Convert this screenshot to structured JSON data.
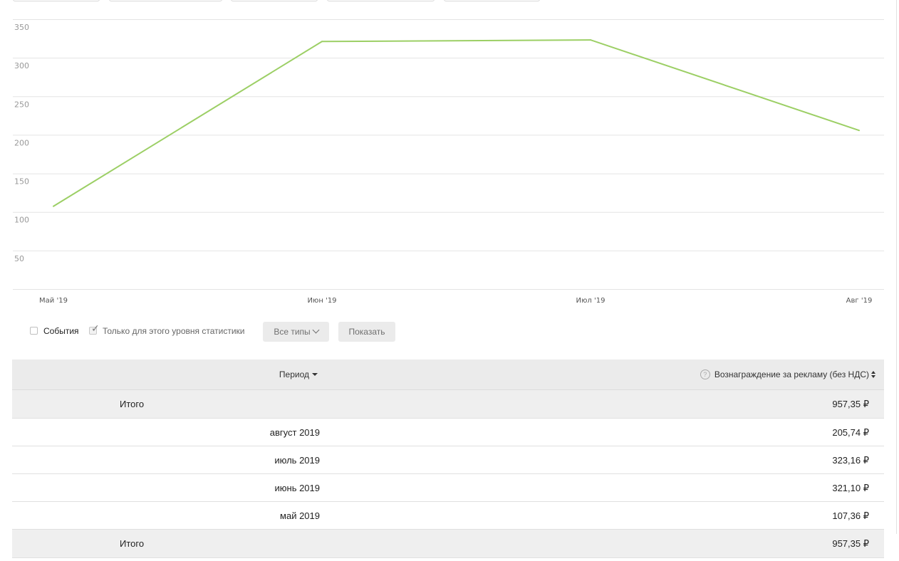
{
  "chart_data": {
    "type": "line",
    "categories": [
      "Май '19",
      "Июн '19",
      "Июл '19",
      "Авг '19"
    ],
    "series": [
      {
        "values": [
          107.36,
          321.1,
          323.16,
          205.74
        ]
      }
    ],
    "yticks": [
      50,
      100,
      150,
      200,
      250,
      300,
      350
    ],
    "ylim": [
      0,
      350
    ],
    "grid": true,
    "color": "#9ccf65"
  },
  "controls": {
    "events_label": "События",
    "events_checked": false,
    "only_level_label": "Только для этого уровня статистики",
    "only_level_checked": true,
    "types_button": "Все типы",
    "show_button": "Показать"
  },
  "table": {
    "col_period": "Период",
    "col_reward": "Вознаграждение за рекламу (без НДС)",
    "help_glyph": "?",
    "total_label": "Итого",
    "total_value": "957,35 ₽",
    "rows": [
      {
        "period": "август 2019",
        "value": "205,74 ₽"
      },
      {
        "period": "июль 2019",
        "value": "323,16 ₽"
      },
      {
        "period": "июнь 2019",
        "value": "321,10 ₽"
      },
      {
        "period": "май 2019",
        "value": "107,36 ₽"
      }
    ],
    "footer_label": "Итого",
    "footer_value": "957,35 ₽"
  }
}
